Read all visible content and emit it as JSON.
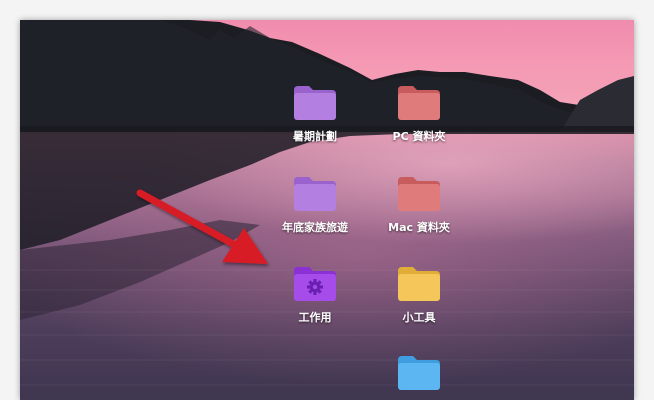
{
  "desktop": {
    "items": [
      {
        "label": "暑期計劃",
        "color": "#b37fe0",
        "tab": "#9a62cc",
        "icon": "folder-icon"
      },
      {
        "label": "PC 資料夾",
        "color": "#e07b7b",
        "tab": "#c85c5c",
        "icon": "folder-icon"
      },
      {
        "label": "年底家族旅遊",
        "color": "#b37fe0",
        "tab": "#9a62cc",
        "icon": "folder-icon"
      },
      {
        "label": "Mac 資料夾",
        "color": "#e07b7b",
        "tab": "#c85c5c",
        "icon": "folder-icon"
      },
      {
        "label": "工作用",
        "color": "#a64cea",
        "tab": "#8a30d4",
        "icon": "gear-folder-icon"
      },
      {
        "label": "小工具",
        "color": "#f5c75a",
        "tab": "#e0ad38",
        "icon": "folder-icon"
      },
      {
        "label": "",
        "color": "#5cb6f2",
        "tab": "#3f9ee0",
        "icon": "folder-icon"
      }
    ]
  },
  "annotation": {
    "arrow_color": "#d81e28",
    "icon": "red-arrow-icon"
  }
}
